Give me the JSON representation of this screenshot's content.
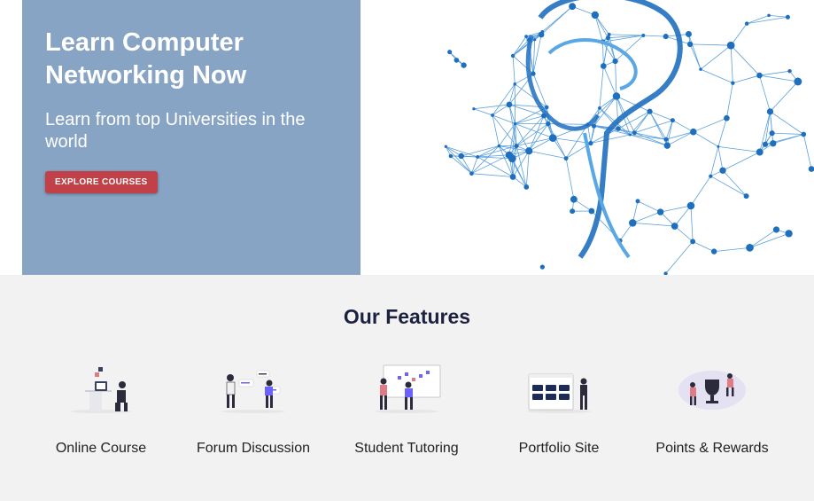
{
  "hero": {
    "title": "Learn Computer Networking Now",
    "subtitle": "Learn from top Universities in the world",
    "button_label": "EXPLORE COURSES",
    "accent_color": "#c24048",
    "panel_color": "#87a4c4",
    "image_icon": "brain-network-illustration"
  },
  "features": {
    "title": "Our Features",
    "items": [
      {
        "label": "Online Course",
        "icon": "online-course-illustration"
      },
      {
        "label": "Forum Discussion",
        "icon": "forum-discussion-illustration"
      },
      {
        "label": "Student Tutoring",
        "icon": "student-tutoring-illustration"
      },
      {
        "label": "Portfolio Site",
        "icon": "portfolio-site-illustration"
      },
      {
        "label": "Points & Rewards",
        "icon": "points-rewards-illustration"
      }
    ]
  }
}
